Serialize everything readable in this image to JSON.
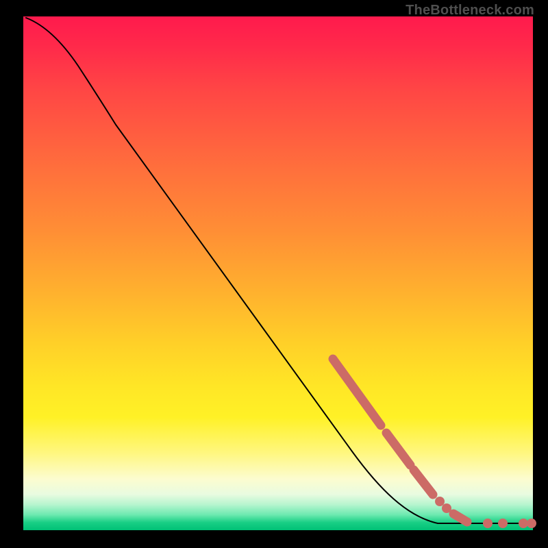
{
  "watermark": "TheBottleneck.com",
  "chart_data": {
    "type": "line",
    "title": "",
    "xlabel": "",
    "ylabel": "",
    "xlim": [
      0,
      100
    ],
    "ylim": [
      0,
      100
    ],
    "grid": false,
    "legend": false,
    "series": [
      {
        "name": "bottleneck-curve",
        "x": [
          0,
          5,
          10,
          15,
          20,
          25,
          30,
          35,
          40,
          45,
          50,
          55,
          60,
          65,
          70,
          75,
          80,
          82,
          84,
          86,
          88,
          90,
          92,
          94,
          96,
          98,
          100
        ],
        "y": [
          100,
          98,
          94,
          89,
          83,
          77,
          71,
          65,
          59,
          53,
          47,
          41,
          35,
          29,
          23,
          17,
          11,
          9,
          7,
          5,
          3,
          2,
          1,
          1,
          1,
          1,
          1
        ]
      }
    ],
    "markers": [
      {
        "name": "cluster-a-start",
        "x": 62,
        "y": 32
      },
      {
        "name": "cluster-a-end",
        "x": 70,
        "y": 23
      },
      {
        "name": "cluster-b-start",
        "x": 71,
        "y": 21
      },
      {
        "name": "cluster-b-end",
        "x": 76,
        "y": 15
      },
      {
        "name": "cluster-c-start",
        "x": 77,
        "y": 14
      },
      {
        "name": "cluster-c-end",
        "x": 80,
        "y": 10
      },
      {
        "name": "point-d",
        "x": 82,
        "y": 8
      },
      {
        "name": "point-e",
        "x": 84,
        "y": 6
      },
      {
        "name": "cluster-f-start",
        "x": 86,
        "y": 3
      },
      {
        "name": "cluster-f-end",
        "x": 88,
        "y": 2
      },
      {
        "name": "flat-g",
        "x": 92,
        "y": 1
      },
      {
        "name": "flat-h",
        "x": 95,
        "y": 1
      },
      {
        "name": "flat-i",
        "x": 99,
        "y": 1
      },
      {
        "name": "flat-j",
        "x": 100,
        "y": 1
      }
    ]
  }
}
